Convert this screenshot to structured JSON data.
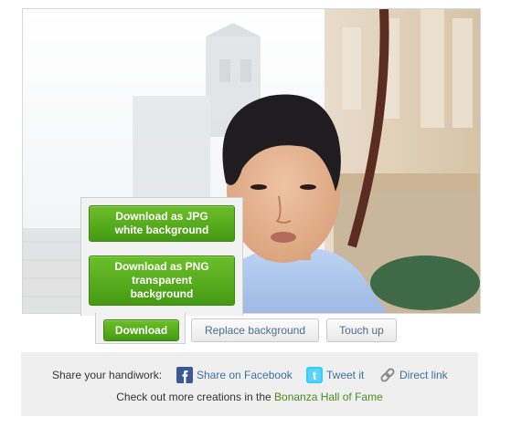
{
  "download_menu": {
    "jpg_label": "Download as JPG\nwhite background",
    "png_label": "Download as PNG\ntransparent\nbackground"
  },
  "actions": {
    "download_label": "Download",
    "replace_label": "Replace background",
    "touchup_label": "Touch up"
  },
  "share": {
    "prompt": "Share your handiwork:",
    "facebook_label": "Share on Facebook",
    "twitter_label": "Tweet it",
    "direct_label": "Direct link",
    "more_prefix": "Check out more creations in the",
    "hall_label": "Bonanza Hall of Fame"
  },
  "colors": {
    "green": "#449a13",
    "link_blue": "#3e6f9c",
    "hall_green": "#4b8a1e",
    "panel_bg": "#efefef"
  },
  "icons": [
    "facebook-icon",
    "twitter-icon",
    "link-chain-icon"
  ]
}
